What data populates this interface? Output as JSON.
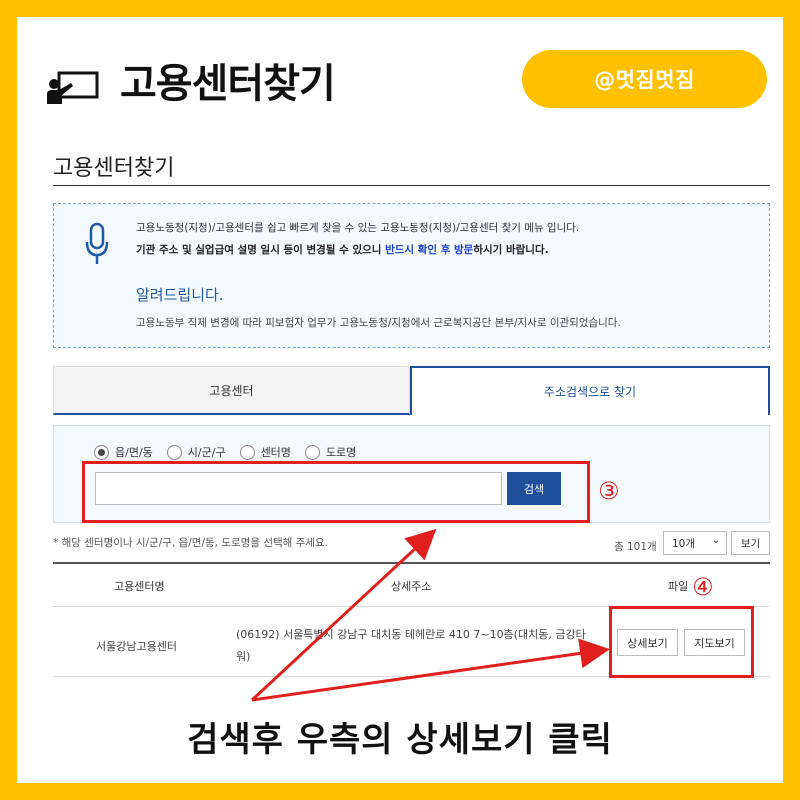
{
  "header": {
    "title": "고용센터찾기",
    "handle": "@멋짐멋짐",
    "icon": "presentation-icon"
  },
  "page": {
    "title": "고용센터찾기"
  },
  "notice": {
    "icon": "microphone-icon",
    "line1": "고용노동청(지청)/고용센터를 쉽고 빠르게 찾을 수 있는 고용노동청(지청)/고용센터 찾기 메뉴 입니다.",
    "line2_pre": "기관 주소 및 실업급여 설명 일시 등이 변경될 수 있으니 ",
    "line2_highlight": "반드시 확인 후 방문",
    "line2_post": "하시기 바랍니다.",
    "heading": "알려드립니다.",
    "line3": "고용노동부 직제 변경에 따라 피보험자 업무가 고용노동청/지청에서 근로복지공단 본부/지사로 이관되었습니다."
  },
  "tabs": {
    "center": "고용센터",
    "address_search": "주소검색으로 찾기"
  },
  "search": {
    "options": [
      "읍/면/동",
      "시/군/구",
      "센터명",
      "도로명"
    ],
    "selected_index": 0,
    "input_value": "",
    "button": "검색"
  },
  "list_controls": {
    "hint": "* 해당 센터명이나 시/군/구, 읍/면/동, 도로명을 선택해 주세요.",
    "total": "총 101개",
    "per_page": "10개",
    "view_button": "보기"
  },
  "table": {
    "headers": [
      "고용센터명",
      "상세주소",
      "파일"
    ],
    "rows": [
      {
        "name": "서울강남고용센터",
        "address": "(06192) 서울특별시 강남구 대치동 테헤란로 410 7~10층(대치동, 금강타워)",
        "detail_button": "상세보기",
        "map_button": "지도보기"
      }
    ]
  },
  "annotations": {
    "step3": "③",
    "step4": "④",
    "caption": "검색후 우측의 상세보기 클릭",
    "color": "#e0201c"
  },
  "colors": {
    "frame": "#ffc000",
    "accent": "#1f4e9b"
  }
}
